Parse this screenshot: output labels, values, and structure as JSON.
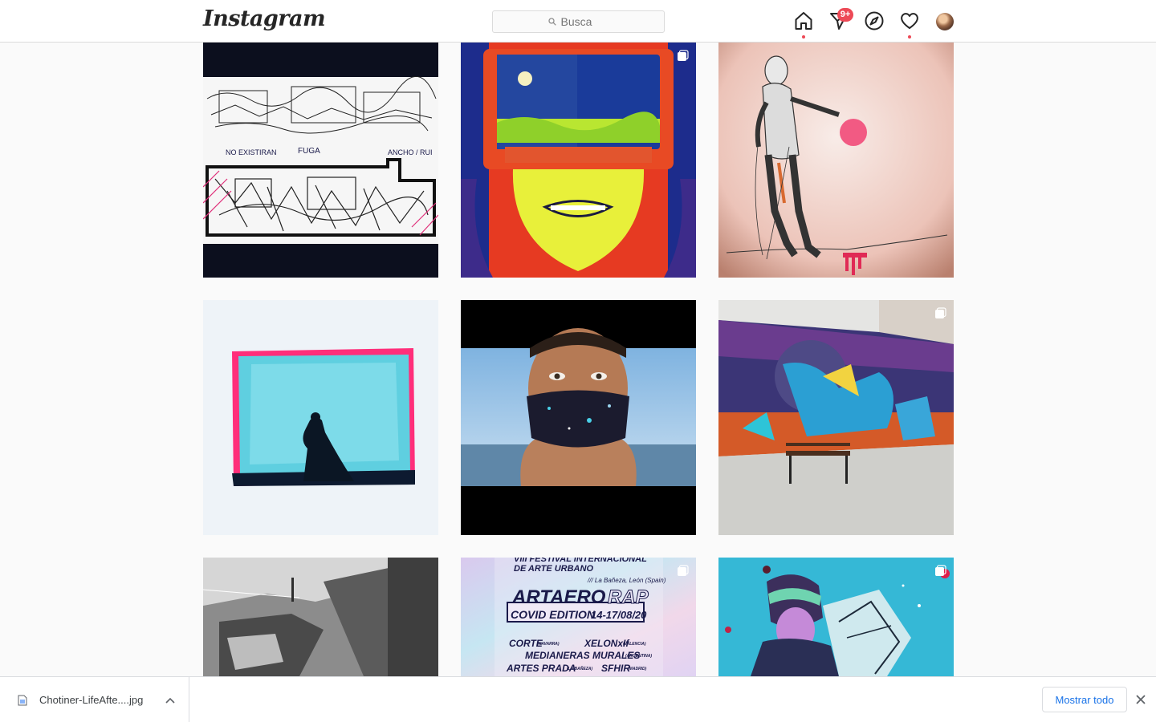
{
  "header": {
    "logo_text": "Instagram",
    "search_placeholder": "Busca",
    "activity_badge": "9+",
    "icons": [
      "home-icon",
      "direct-message-icon",
      "explore-icon",
      "activity-heart-icon"
    ]
  },
  "grid": {
    "posts": [
      {
        "kind": "sketch",
        "multi": false
      },
      {
        "kind": "visor-mural",
        "multi": true
      },
      {
        "kind": "astronaut-wall",
        "multi": false
      },
      {
        "kind": "silhouette-canvas",
        "multi": false
      },
      {
        "kind": "mask-portrait",
        "multi": false
      },
      {
        "kind": "space-mural",
        "multi": true
      },
      {
        "kind": "bw-photo",
        "multi": false
      },
      {
        "kind": "festival-poster",
        "multi": true
      },
      {
        "kind": "crystal-mural",
        "multi": true
      }
    ],
    "poster_lines": {
      "line1": "VIII FESTIVAL INTERNACIONAL",
      "line2": "DE ARTE URBANO",
      "line3": "/// La Bañeza, León (Spain)",
      "line4a": "ARTAERO",
      "line4b": "RAP",
      "line5": "COVID EDITION",
      "line5b": "14-17/08/20",
      "line6a": "CORTE",
      "line6a_sub": "(NAVARRA)",
      "line6b": "XELONxIf",
      "line6b_sub": "(VALENCIA)",
      "line7": "MEDIANERAS MURALES",
      "line7_sub": "(ARGENTINA)",
      "line8a": "ARTES PRADA",
      "line8a_sub": "(LA BAÑEZA)",
      "line8b": "SFHIR",
      "line8b_sub": "(MADRID)"
    },
    "sketch_text": {
      "a": "NO EXISTIRAN",
      "b": "FUGA",
      "c": "ANCHO / RUI"
    }
  },
  "download_bar": {
    "file_name": "Chotiner-LifeAfte....jpg",
    "show_all_label": "Mostrar todo"
  },
  "colors": {
    "notification_red": "#ed4956",
    "link_blue": "#1a73e8",
    "border": "#dbdbdb",
    "page_bg": "#fafafa"
  }
}
